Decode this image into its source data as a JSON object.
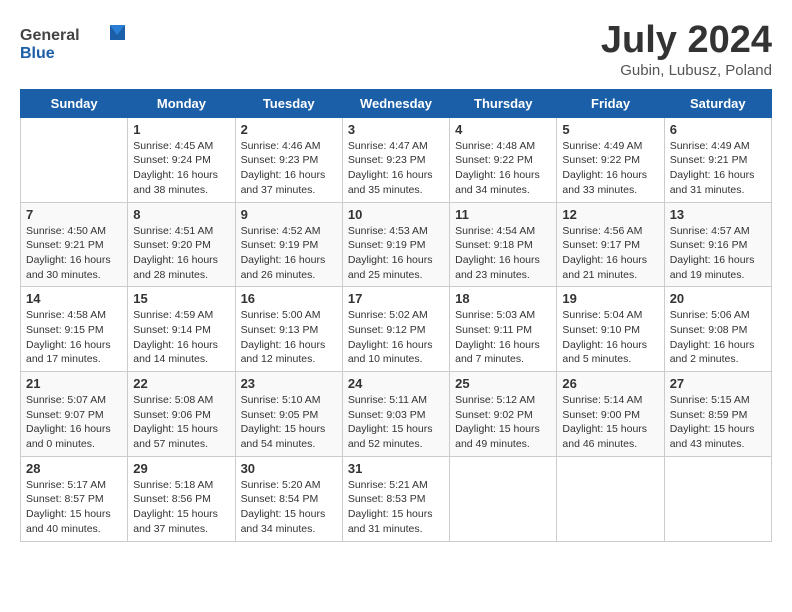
{
  "header": {
    "logo": {
      "text_general": "General",
      "text_blue": "Blue"
    },
    "title": "July 2024",
    "subtitle": "Gubin, Lubusz, Poland"
  },
  "calendar": {
    "days_of_week": [
      "Sunday",
      "Monday",
      "Tuesday",
      "Wednesday",
      "Thursday",
      "Friday",
      "Saturday"
    ],
    "weeks": [
      [
        {
          "day": "",
          "info": ""
        },
        {
          "day": "1",
          "info": "Sunrise: 4:45 AM\nSunset: 9:24 PM\nDaylight: 16 hours\nand 38 minutes."
        },
        {
          "day": "2",
          "info": "Sunrise: 4:46 AM\nSunset: 9:23 PM\nDaylight: 16 hours\nand 37 minutes."
        },
        {
          "day": "3",
          "info": "Sunrise: 4:47 AM\nSunset: 9:23 PM\nDaylight: 16 hours\nand 35 minutes."
        },
        {
          "day": "4",
          "info": "Sunrise: 4:48 AM\nSunset: 9:22 PM\nDaylight: 16 hours\nand 34 minutes."
        },
        {
          "day": "5",
          "info": "Sunrise: 4:49 AM\nSunset: 9:22 PM\nDaylight: 16 hours\nand 33 minutes."
        },
        {
          "day": "6",
          "info": "Sunrise: 4:49 AM\nSunset: 9:21 PM\nDaylight: 16 hours\nand 31 minutes."
        }
      ],
      [
        {
          "day": "7",
          "info": "Sunrise: 4:50 AM\nSunset: 9:21 PM\nDaylight: 16 hours\nand 30 minutes."
        },
        {
          "day": "8",
          "info": "Sunrise: 4:51 AM\nSunset: 9:20 PM\nDaylight: 16 hours\nand 28 minutes."
        },
        {
          "day": "9",
          "info": "Sunrise: 4:52 AM\nSunset: 9:19 PM\nDaylight: 16 hours\nand 26 minutes."
        },
        {
          "day": "10",
          "info": "Sunrise: 4:53 AM\nSunset: 9:19 PM\nDaylight: 16 hours\nand 25 minutes."
        },
        {
          "day": "11",
          "info": "Sunrise: 4:54 AM\nSunset: 9:18 PM\nDaylight: 16 hours\nand 23 minutes."
        },
        {
          "day": "12",
          "info": "Sunrise: 4:56 AM\nSunset: 9:17 PM\nDaylight: 16 hours\nand 21 minutes."
        },
        {
          "day": "13",
          "info": "Sunrise: 4:57 AM\nSunset: 9:16 PM\nDaylight: 16 hours\nand 19 minutes."
        }
      ],
      [
        {
          "day": "14",
          "info": "Sunrise: 4:58 AM\nSunset: 9:15 PM\nDaylight: 16 hours\nand 17 minutes."
        },
        {
          "day": "15",
          "info": "Sunrise: 4:59 AM\nSunset: 9:14 PM\nDaylight: 16 hours\nand 14 minutes."
        },
        {
          "day": "16",
          "info": "Sunrise: 5:00 AM\nSunset: 9:13 PM\nDaylight: 16 hours\nand 12 minutes."
        },
        {
          "day": "17",
          "info": "Sunrise: 5:02 AM\nSunset: 9:12 PM\nDaylight: 16 hours\nand 10 minutes."
        },
        {
          "day": "18",
          "info": "Sunrise: 5:03 AM\nSunset: 9:11 PM\nDaylight: 16 hours\nand 7 minutes."
        },
        {
          "day": "19",
          "info": "Sunrise: 5:04 AM\nSunset: 9:10 PM\nDaylight: 16 hours\nand 5 minutes."
        },
        {
          "day": "20",
          "info": "Sunrise: 5:06 AM\nSunset: 9:08 PM\nDaylight: 16 hours\nand 2 minutes."
        }
      ],
      [
        {
          "day": "21",
          "info": "Sunrise: 5:07 AM\nSunset: 9:07 PM\nDaylight: 16 hours\nand 0 minutes."
        },
        {
          "day": "22",
          "info": "Sunrise: 5:08 AM\nSunset: 9:06 PM\nDaylight: 15 hours\nand 57 minutes."
        },
        {
          "day": "23",
          "info": "Sunrise: 5:10 AM\nSunset: 9:05 PM\nDaylight: 15 hours\nand 54 minutes."
        },
        {
          "day": "24",
          "info": "Sunrise: 5:11 AM\nSunset: 9:03 PM\nDaylight: 15 hours\nand 52 minutes."
        },
        {
          "day": "25",
          "info": "Sunrise: 5:12 AM\nSunset: 9:02 PM\nDaylight: 15 hours\nand 49 minutes."
        },
        {
          "day": "26",
          "info": "Sunrise: 5:14 AM\nSunset: 9:00 PM\nDaylight: 15 hours\nand 46 minutes."
        },
        {
          "day": "27",
          "info": "Sunrise: 5:15 AM\nSunset: 8:59 PM\nDaylight: 15 hours\nand 43 minutes."
        }
      ],
      [
        {
          "day": "28",
          "info": "Sunrise: 5:17 AM\nSunset: 8:57 PM\nDaylight: 15 hours\nand 40 minutes."
        },
        {
          "day": "29",
          "info": "Sunrise: 5:18 AM\nSunset: 8:56 PM\nDaylight: 15 hours\nand 37 minutes."
        },
        {
          "day": "30",
          "info": "Sunrise: 5:20 AM\nSunset: 8:54 PM\nDaylight: 15 hours\nand 34 minutes."
        },
        {
          "day": "31",
          "info": "Sunrise: 5:21 AM\nSunset: 8:53 PM\nDaylight: 15 hours\nand 31 minutes."
        },
        {
          "day": "",
          "info": ""
        },
        {
          "day": "",
          "info": ""
        },
        {
          "day": "",
          "info": ""
        }
      ]
    ]
  }
}
